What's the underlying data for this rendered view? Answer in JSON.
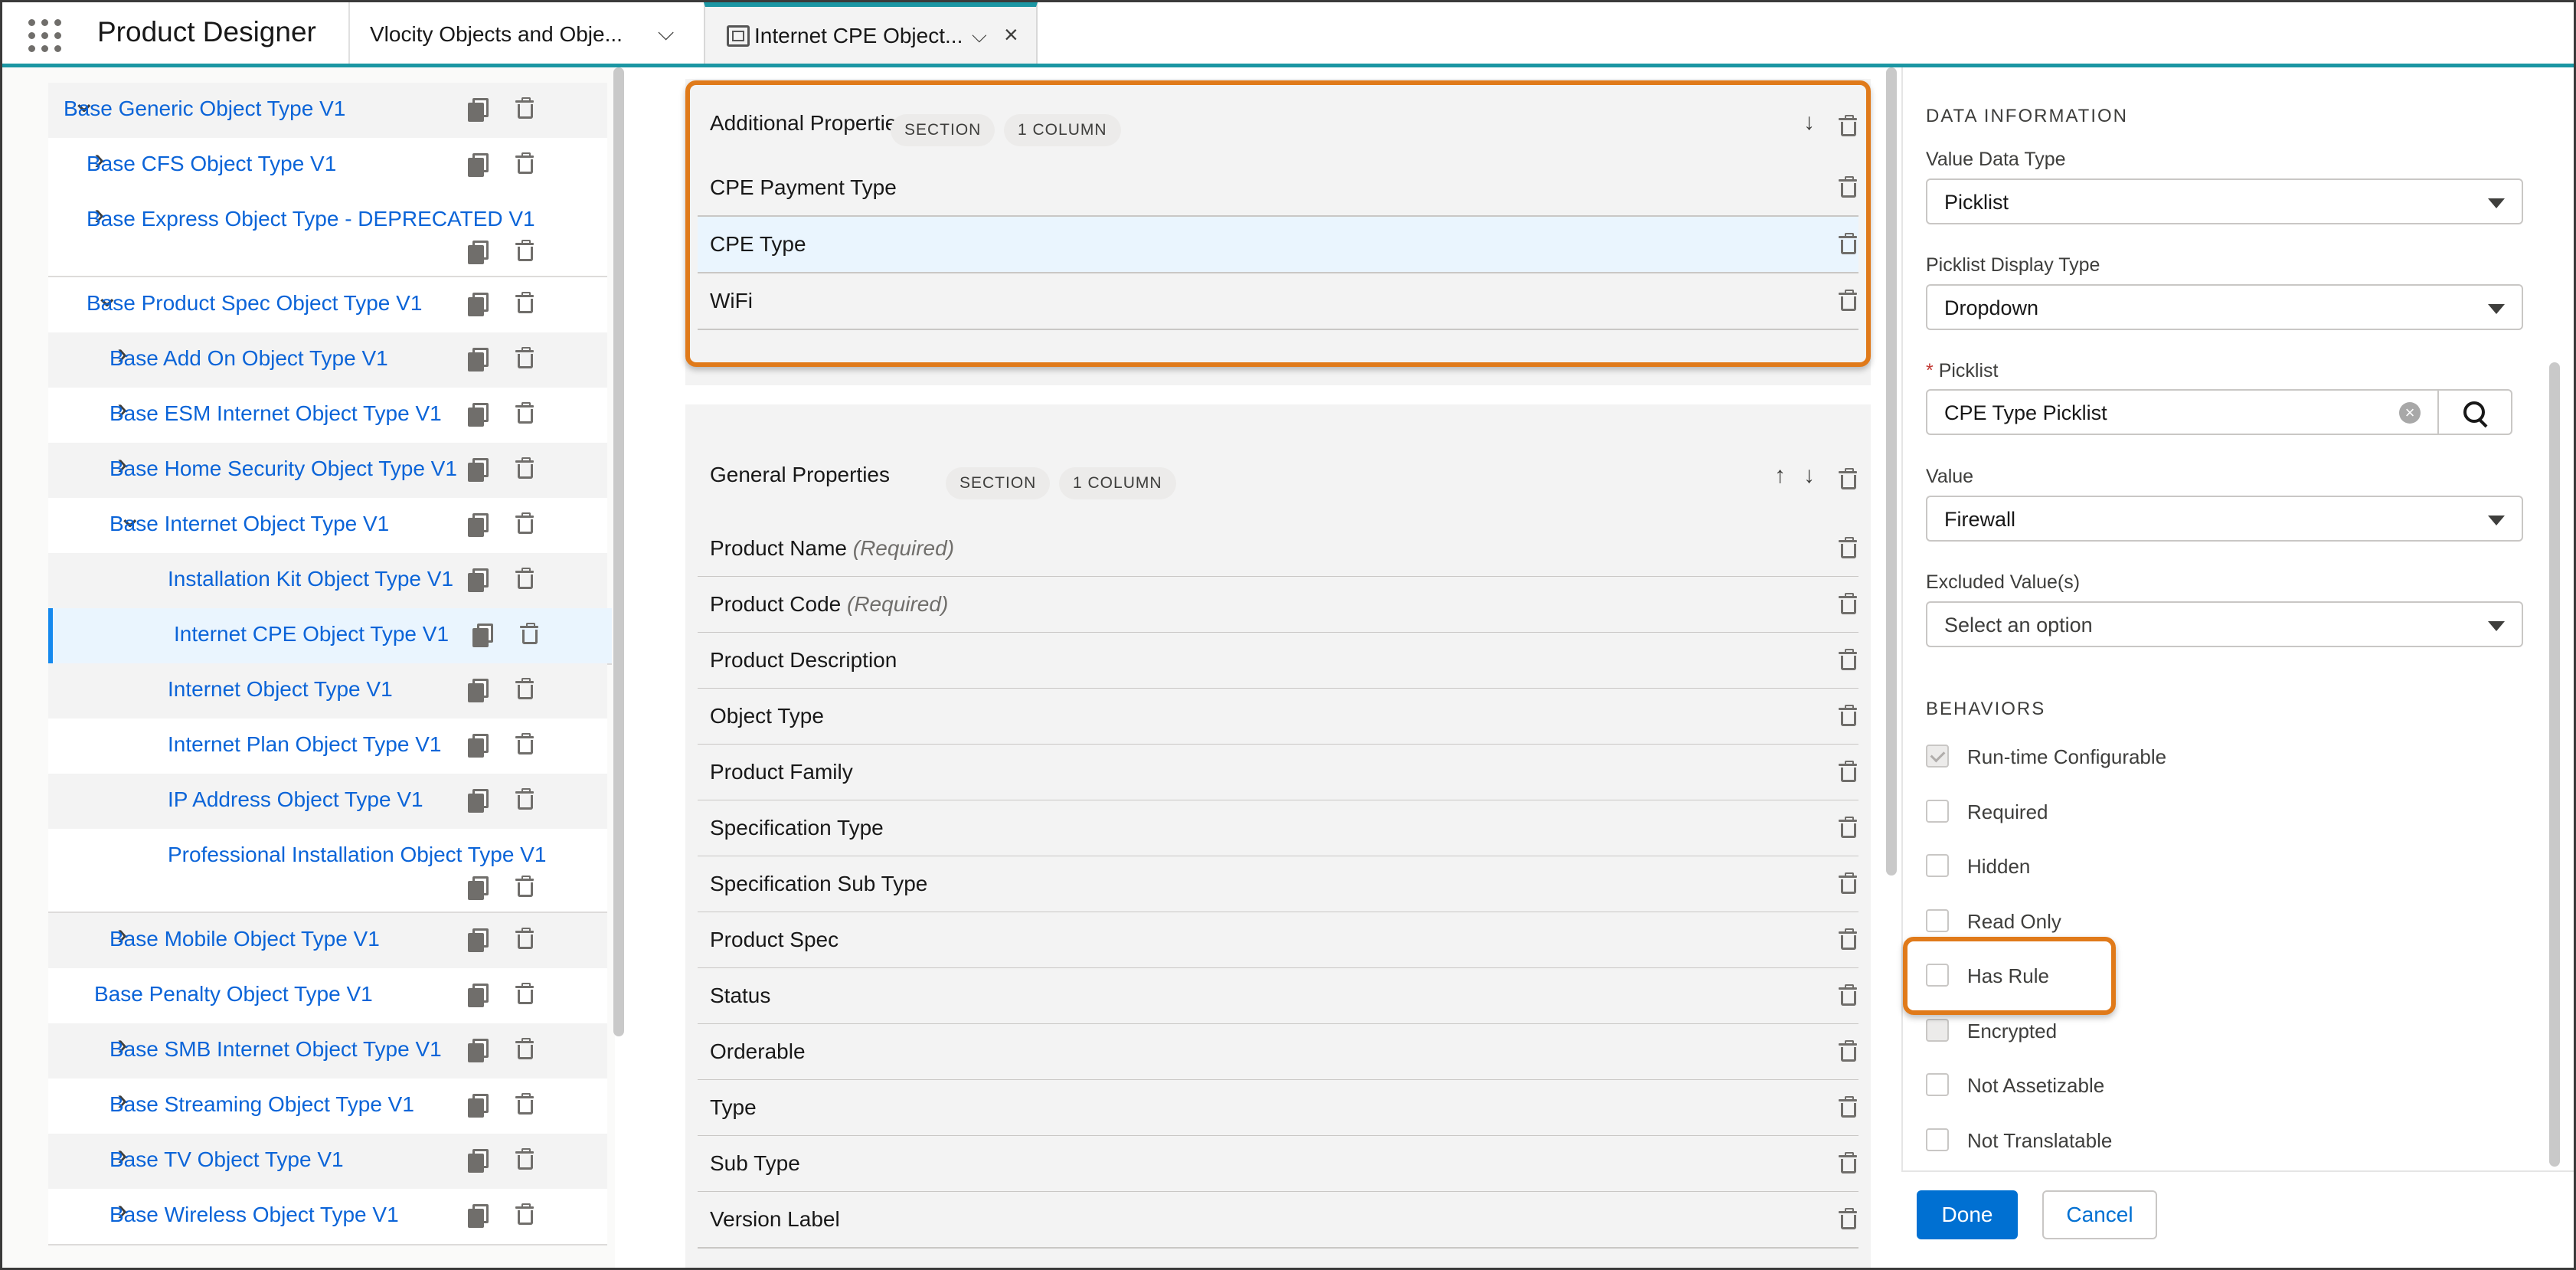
{
  "header": {
    "app_title": "Product Designer",
    "tab1_label": "Vlocity Objects and Obje...",
    "tab2_label": "Internet CPE Object..."
  },
  "tree": {
    "items": [
      {
        "label": "Base Generic Object Type V1"
      },
      {
        "label": "Base CFS Object Type V1"
      },
      {
        "label": "Base Express Object Type - DEPRECATED V1"
      },
      {
        "label": "Base Product Spec Object Type V1"
      },
      {
        "label": "Base Add On Object Type V1"
      },
      {
        "label": "Base ESM Internet Object Type V1"
      },
      {
        "label": "Base Home Security Object Type V1"
      },
      {
        "label": "Base Internet Object Type V1"
      },
      {
        "label": "Installation Kit Object Type V1"
      },
      {
        "label": "Internet CPE Object Type V1"
      },
      {
        "label": "Internet Object Type V1"
      },
      {
        "label": "Internet Plan Object Type V1"
      },
      {
        "label": "IP Address Object Type V1"
      },
      {
        "label": "Professional Installation Object Type V1"
      },
      {
        "label": "Base Mobile Object Type V1"
      },
      {
        "label": "Base Penalty Object Type V1"
      },
      {
        "label": "Base SMB Internet Object Type V1"
      },
      {
        "label": "Base Streaming Object Type V1"
      },
      {
        "label": "Base TV Object Type V1"
      },
      {
        "label": "Base Wireless Object Type V1"
      }
    ]
  },
  "layout": {
    "section_badge": "SECTION",
    "column_badge": "1 COLUMN",
    "additional": {
      "title": "Additional Properties",
      "rows": [
        "CPE Payment Type",
        "CPE Type",
        "WiFi"
      ]
    },
    "general": {
      "title": "General Properties",
      "required_suffix": "(Required)",
      "rows": [
        "Product Name",
        "Product Code",
        "Product Description",
        "Object Type",
        "Product Family",
        "Specification Type",
        "Specification Sub Type",
        "Product Spec",
        "Status",
        "Orderable",
        "Type",
        "Sub Type",
        "Version Label"
      ]
    }
  },
  "details": {
    "data_heading": "DATA INFORMATION",
    "value_data_type_label": "Value Data Type",
    "value_data_type": "Picklist",
    "picklist_display_label": "Picklist Display Type",
    "picklist_display": "Dropdown",
    "picklist_label": "Picklist",
    "picklist_value": "CPE Type Picklist",
    "value_label": "Value",
    "value": "Firewall",
    "excluded_label": "Excluded Value(s)",
    "excluded_placeholder": "Select an option",
    "behaviors_heading": "BEHAVIORS",
    "behaviors": [
      {
        "label": "Run-time Configurable",
        "checked": true,
        "disabled": true
      },
      {
        "label": "Required",
        "checked": false,
        "disabled": false
      },
      {
        "label": "Hidden",
        "checked": false,
        "disabled": false
      },
      {
        "label": "Read Only",
        "checked": false,
        "disabled": false
      },
      {
        "label": "Has Rule",
        "checked": false,
        "disabled": false
      },
      {
        "label": "Encrypted",
        "checked": false,
        "disabled": true
      },
      {
        "label": "Not Assetizable",
        "checked": false,
        "disabled": false
      },
      {
        "label": "Not Translatable",
        "checked": false,
        "disabled": false
      }
    ]
  },
  "footer": {
    "done_label": "Done",
    "cancel_label": "Cancel"
  },
  "colors": {
    "accent": "#1b96a3",
    "link": "#0b64d8",
    "brand_button": "#0070d2",
    "highlight_outline": "#e07a1a"
  }
}
